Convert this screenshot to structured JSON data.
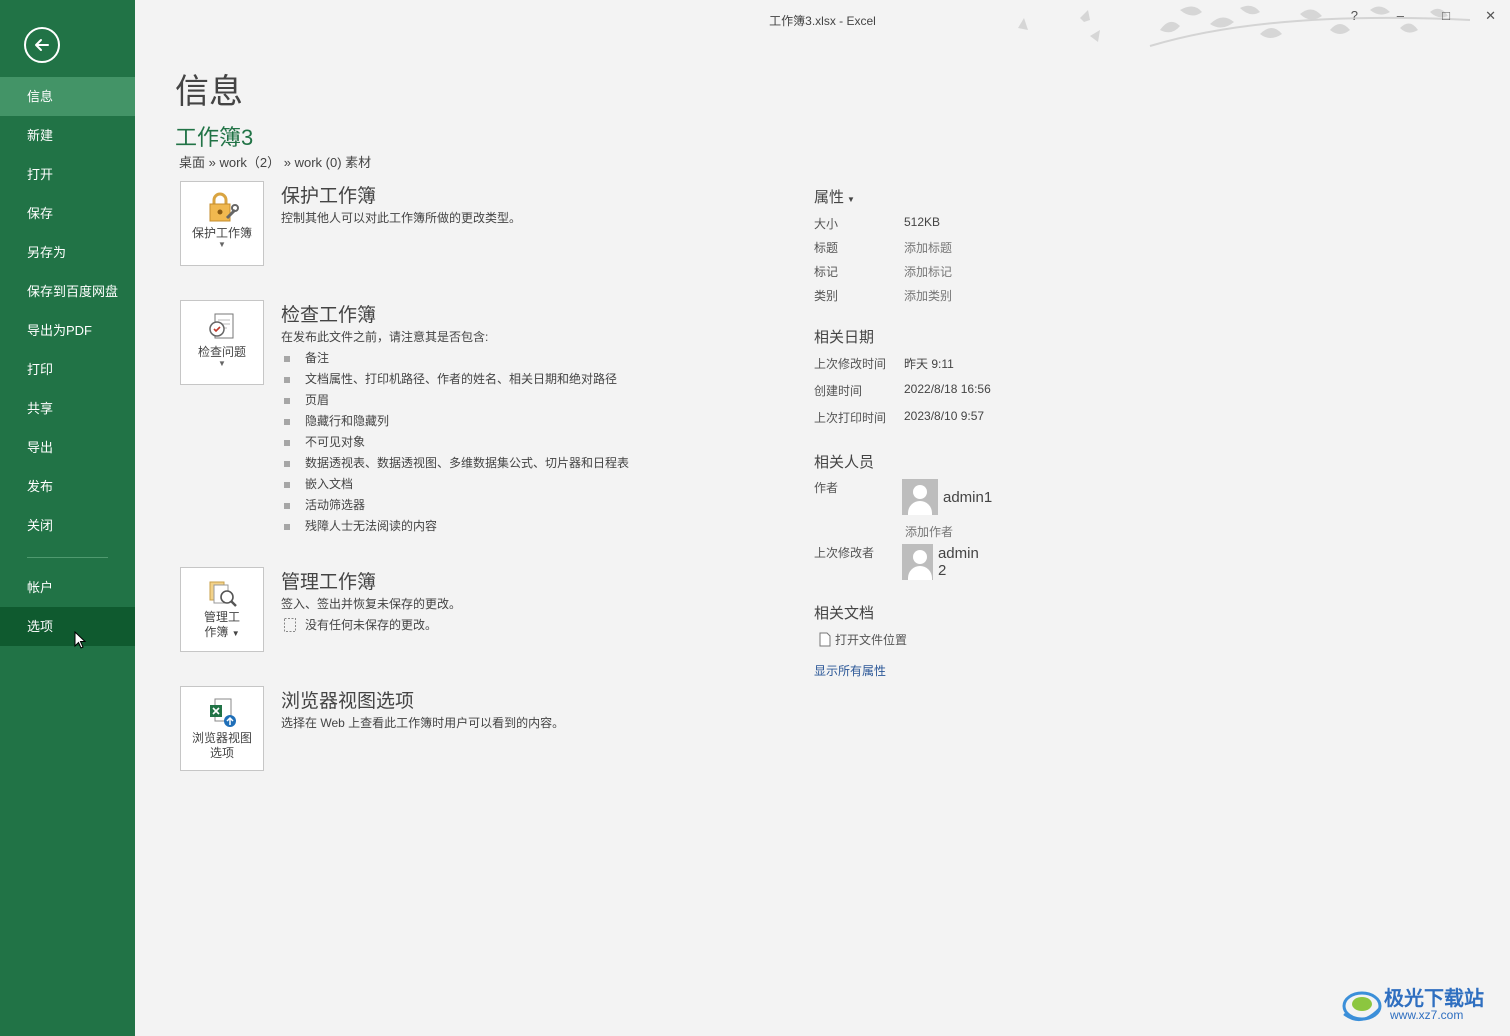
{
  "window": {
    "title": "工作簿3.xlsx - Excel",
    "help": "?",
    "minimize": "–",
    "maximize": "□",
    "close": "✕"
  },
  "sidebar": {
    "items": [
      {
        "label": "信息"
      },
      {
        "label": "新建"
      },
      {
        "label": "打开"
      },
      {
        "label": "保存"
      },
      {
        "label": "另存为"
      },
      {
        "label": "保存到百度网盘"
      },
      {
        "label": "导出为PDF"
      },
      {
        "label": "打印"
      },
      {
        "label": "共享"
      },
      {
        "label": "导出"
      },
      {
        "label": "发布"
      },
      {
        "label": "关闭"
      }
    ],
    "bottom_items": [
      {
        "label": "帐户"
      },
      {
        "label": "选项"
      }
    ]
  },
  "main": {
    "heading": "信息",
    "workbook_name": "工作簿3",
    "breadcrumb": "桌面 » work（2） » work (0) 素材",
    "protect": {
      "tile_label": "保护工作簿",
      "title": "保护工作簿",
      "description": "控制其他人可以对此工作簿所做的更改类型。"
    },
    "inspect": {
      "tile_label": "检查问题",
      "title": "检查工作簿",
      "description": "在发布此文件之前，请注意其是否包含:",
      "items": [
        "备注",
        "文档属性、打印机路径、作者的姓名、相关日期和绝对路径",
        "页眉",
        "隐藏行和隐藏列",
        "不可见对象",
        "数据透视表、数据透视图、多维数据集公式、切片器和日程表",
        "嵌入文档",
        "活动筛选器",
        "残障人士无法阅读的内容"
      ]
    },
    "manage": {
      "tile_label_line1": "管理工",
      "tile_label_line2": "作簿",
      "title": "管理工作簿",
      "description": "签入、签出并恢复未保存的更改。",
      "note": "没有任何未保存的更改。"
    },
    "browser": {
      "tile_label_line1": "浏览器视图",
      "tile_label_line2": "选项",
      "title": "浏览器视图选项",
      "description": "选择在 Web 上查看此工作簿时用户可以看到的内容。"
    }
  },
  "properties": {
    "heading": "属性",
    "size_label": "大小",
    "size_value": "512KB",
    "title_label": "标题",
    "title_value": "添加标题",
    "tags_label": "标记",
    "tags_value": "添加标记",
    "category_label": "类别",
    "category_value": "添加类别",
    "dates_heading": "相关日期",
    "modified_label": "上次修改时间",
    "modified_value": "昨天 9:11",
    "created_label": "创建时间",
    "created_value": "2022/8/18 16:56",
    "printed_label": "上次打印时间",
    "printed_value": "2023/8/10 9:57",
    "people_heading": "相关人员",
    "author_label": "作者",
    "author_name": "admin1",
    "add_author": "添加作者",
    "last_modified_by_label": "上次修改者",
    "last_modified_by_name": "admin 2",
    "docs_heading": "相关文档",
    "open_location": "打开文件位置",
    "show_all": "显示所有属性"
  },
  "watermark": {
    "text": "极光下载站",
    "url": "www.xz7.com"
  },
  "colors": {
    "accent": "#217346",
    "sidebar_active": "#439467",
    "sidebar_selected": "#0f5a2f",
    "background": "#f3f3f3",
    "link": "#2b5797"
  }
}
